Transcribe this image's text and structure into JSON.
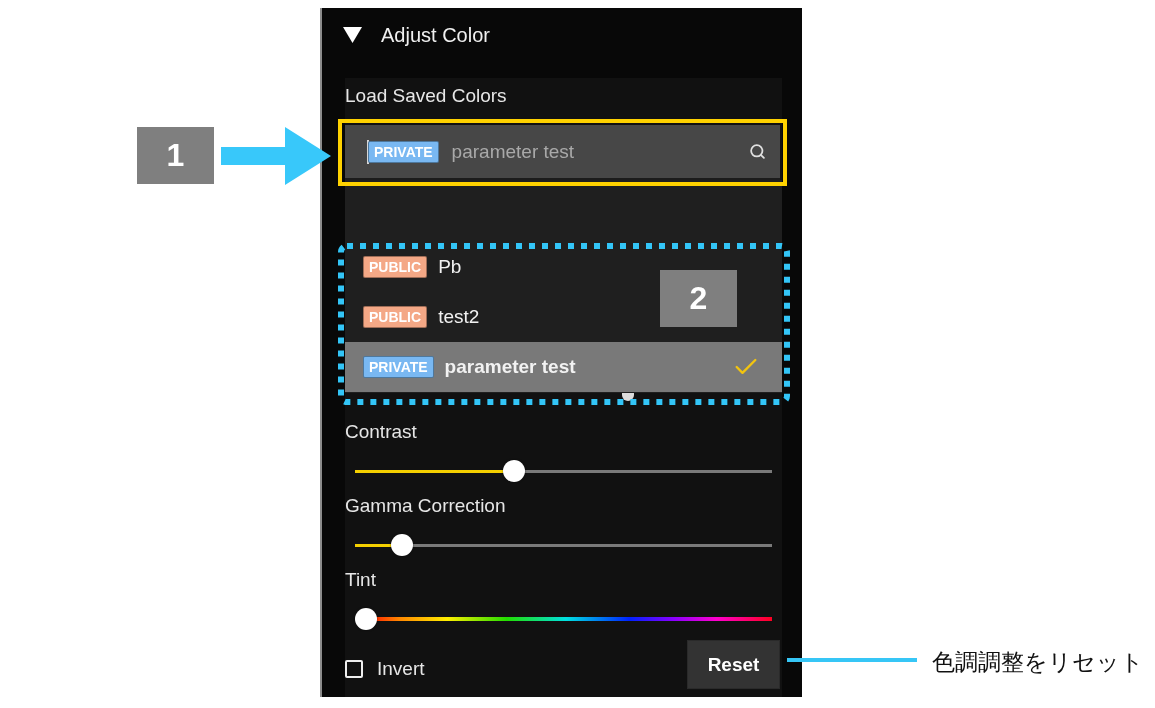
{
  "panel": {
    "header": {
      "title": "Adjust Color",
      "expanded": true
    },
    "saved_colors": {
      "label": "Load Saved Colors",
      "search": {
        "badge": "PRIVATE",
        "kind": "private",
        "value": "parameter test"
      },
      "items": [
        {
          "badge": "PUBLIC",
          "kind": "public",
          "name": "Pb",
          "selected": false
        },
        {
          "badge": "PUBLIC",
          "kind": "public",
          "name": "test2",
          "selected": false
        },
        {
          "badge": "PRIVATE",
          "kind": "private",
          "name": "parameter test",
          "selected": true
        }
      ]
    },
    "sliders": [
      {
        "label": "Contrast",
        "kind": "plain",
        "level": 0.375
      },
      {
        "label": "Gamma Correction",
        "kind": "plain",
        "level": 0.09
      },
      {
        "label": "Tint",
        "kind": "hue",
        "level": 0
      }
    ],
    "invert": {
      "label": "Invert",
      "checked": false
    },
    "reset_button": {
      "label": "Reset"
    }
  },
  "callouts": [
    {
      "number": "1"
    },
    {
      "number": "2"
    }
  ],
  "note": {
    "text": "色調調整をリセット"
  }
}
